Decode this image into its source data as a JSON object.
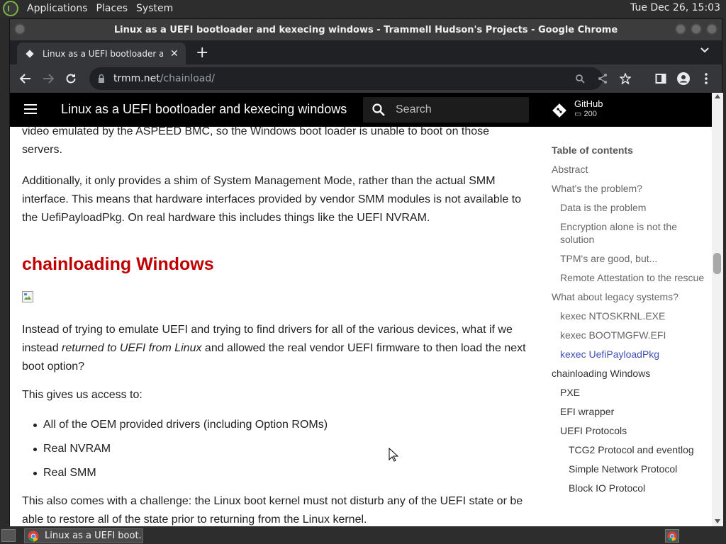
{
  "system_panel": {
    "menus": [
      "Applications",
      "Places",
      "System"
    ],
    "clock": "Tue Dec 26, 15:03"
  },
  "window": {
    "title": "Linux as a UEFI bootloader and kexecing windows - Trammell Hudson's Projects - Google Chrome"
  },
  "tab": {
    "title": "Linux as a UEFI bootloader and kexecing windows"
  },
  "toolbar": {
    "url_host": "trmm.net",
    "url_path": "/chainload/"
  },
  "site_header": {
    "title": "Linux as a UEFI bootloader and kexecing windows",
    "search_placeholder": "Search",
    "github_label": "GitHub",
    "github_stars": "200"
  },
  "article": {
    "para_top": "video emulated by the ASPEED BMC, so the Windows boot loader is unable to boot on those servers.",
    "para_smm": "Additionally, it only provides a shim of System Management Mode, rather than the actual SMM interface. This means that hardware interfaces provided by vendor SMM modules is not available to the UefiPayloadPkg. On real hardware this includes things like the UEFI NVRAM.",
    "heading": "chainloading Windows",
    "para_instead_1": "Instead of trying to emulate UEFI and trying to find drivers for all of the various devices, what if we instead ",
    "para_instead_em": "returned to UEFI from Linux",
    "para_instead_2": " and allowed the real vendor UEFI firmware to then load the next boot option?",
    "para_access": "This gives us access to:",
    "bullets": [
      "All of the OEM provided drivers (including Option ROMs)",
      "Real NVRAM",
      "Real SMM"
    ],
    "para_challenge": "This also comes with a challenge: the Linux boot kernel must not disturb any of the UEFI state or be able to restore all of the state prior to returning from the Linux kernel."
  },
  "toc": {
    "title": "Table of contents",
    "items": [
      "Abstract",
      "What's the problem?",
      "Data is the problem",
      "Encryption alone is not the solution",
      "TPM's are good, but...",
      "Remote Attestation to the rescue",
      "What about legacy systems?",
      "kexec NTOSKRNL.EXE",
      "kexec BOOTMGFW.EFI",
      "kexec UefiPayloadPkg",
      "chainloading Windows",
      "PXE",
      "EFI wrapper",
      "UEFI Protocols",
      "TCG2 Protocol and eventlog",
      "Simple Network Protocol",
      "Block IO Protocol"
    ]
  },
  "taskbar": {
    "task_label": "Linux as a UEFI boot..."
  },
  "colors": {
    "heading_red": "#c00000",
    "toc_active": "#3f51b5",
    "header_bg": "#000000"
  }
}
